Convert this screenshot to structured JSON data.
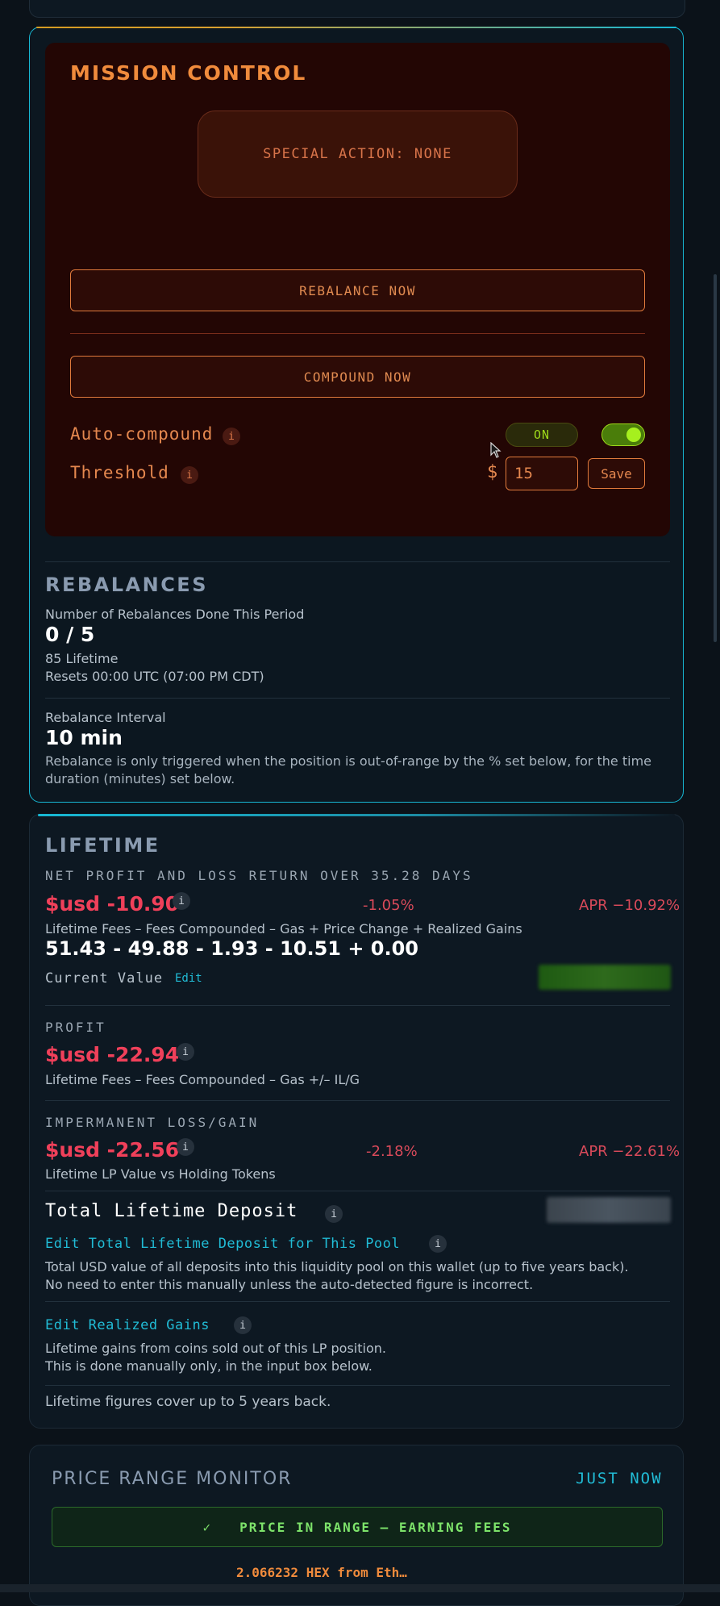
{
  "mission_control": {
    "title": "MISSION CONTROL",
    "special_action": "SPECIAL ACTION: NONE",
    "rebalance_button": "REBALANCE NOW",
    "compound_button": "COMPOUND NOW",
    "auto_compound_label": "Auto-compound",
    "auto_compound_state": "ON",
    "threshold_label": "Threshold",
    "threshold_currency": "$",
    "threshold_value": "15",
    "save_button": "Save",
    "info_glyph": "i"
  },
  "rebalances": {
    "title": "REBALANCES",
    "count_label": "Number of Rebalances Done This Period",
    "count_value": "0 / 5",
    "lifetime": "85 Lifetime",
    "resets": "Resets 00:00 UTC (07:00 PM CDT)",
    "interval_label": "Rebalance Interval",
    "interval_value": "10 min",
    "interval_note": "Rebalance is only triggered when the position is out-of-range by the % set below, for the time duration (minutes) set below."
  },
  "lifetime": {
    "title": "LIFETIME",
    "net_label": "NET PROFIT AND LOSS RETURN OVER 35.28 DAYS",
    "net_value": "$usd -10.90",
    "net_pct": "-1.05%",
    "net_apr": "APR −10.92%",
    "formula_label": "Lifetime Fees – Fees Compounded – Gas + Price Change + Realized Gains",
    "formula_value": "51.43 - 49.88 - 1.93 - 10.51 + 0.00",
    "current_value_label": "Current Value",
    "edit_link": "Edit",
    "profit_label": "PROFIT",
    "profit_value": "$usd -22.94",
    "profit_caption": "Lifetime Fees – Fees Compounded – Gas +/– IL/G",
    "il_label": "IMPERMANENT LOSS/GAIN",
    "il_value": "$usd -22.56",
    "il_pct": "-2.18%",
    "il_apr": "APR −22.61%",
    "il_caption": "Lifetime LP Value vs Holding Tokens",
    "deposit_title": "Total Lifetime Deposit",
    "deposit_edit_link": "Edit Total Lifetime Deposit for This Pool",
    "deposit_caption_1": "Total USD value of all deposits into this liquidity pool on this wallet (up to five years back).",
    "deposit_caption_2": "No need to enter this manually unless the auto-detected figure is incorrect.",
    "realized_edit_link": "Edit Realized Gains",
    "realized_caption_1": "Lifetime gains from coins sold out of this LP position.",
    "realized_caption_2": "This is done manually only, in the input box below.",
    "footer_note": "Lifetime figures cover up to 5 years back.",
    "info_glyph": "i"
  },
  "price_range": {
    "title": "PRICE RANGE MONITOR",
    "updated": "JUST NOW",
    "status_check": "✓",
    "status": "PRICE IN RANGE — EARNING FEES",
    "pair": "2.066232 HEX from Eth…"
  },
  "colors": {
    "accent_cyan": "#17b8d4",
    "mission_bg": "#230604",
    "orange": "#f08b3c",
    "negative_red": "#f0405a",
    "toggle_green": "#a6f01e"
  }
}
